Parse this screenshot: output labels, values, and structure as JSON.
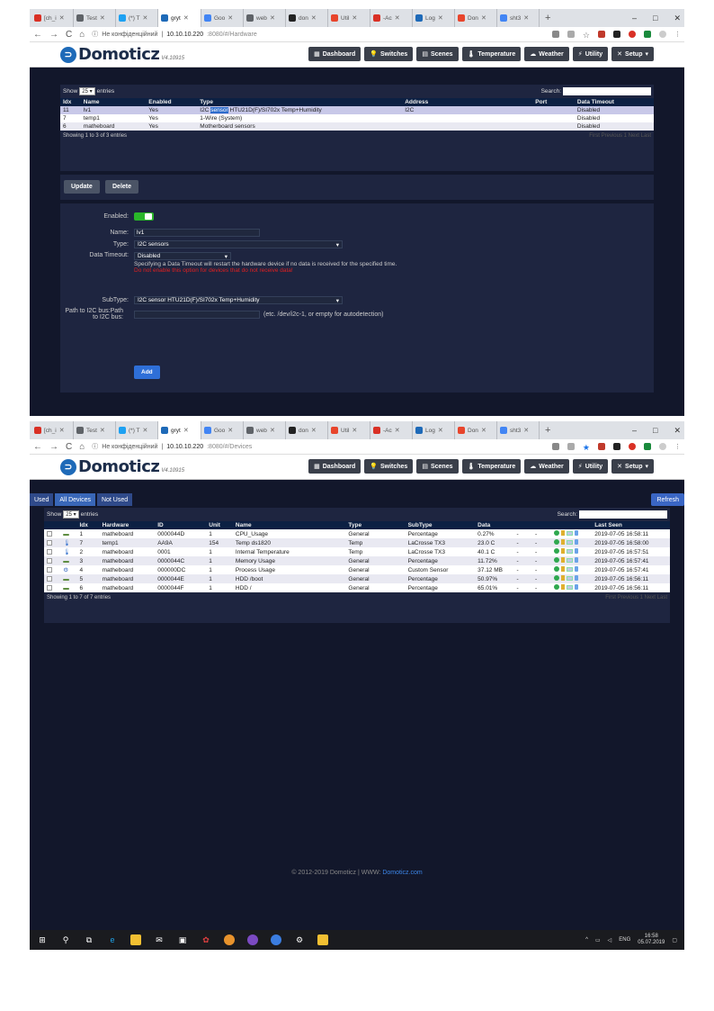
{
  "browser": {
    "tabs": [
      "[ch_i",
      "Test",
      "(*) T",
      "gryt",
      "Goo",
      "web",
      "don",
      "Util",
      "-Ac",
      "Log",
      "Don",
      "sht3"
    ],
    "tab_colors": [
      "#d93025",
      "#5f6368",
      "#1da1f2",
      "#1e6ab8",
      "#4285f4",
      "#5f6368",
      "#222222",
      "#e8452c",
      "#d93025",
      "#1e6ab8",
      "#e8452c",
      "#4285f4"
    ],
    "security_text": "Не конфіденційний",
    "host1": "10.10.10.220",
    "path1": ":8080/#/Hardware",
    "host2": "10.10.10.220",
    "path2": ":8080/#/Devices",
    "min": "–",
    "max": "□",
    "close": "✕",
    "plus": "+"
  },
  "app": {
    "logo": "Domoticz",
    "version": "V4.10915",
    "menu": [
      "Dashboard",
      "Switches",
      "Scenes",
      "Temperature",
      "Weather",
      "Utility",
      "Setup"
    ]
  },
  "hardware": {
    "show_prefix": "Show",
    "show_value": "25",
    "show_suffix": "entries",
    "search_label": "Search:",
    "columns": [
      "Idx",
      "Name",
      "Enabled",
      "Type",
      "Address",
      "Port",
      "Data Timeout"
    ],
    "rows": [
      {
        "idx": "11",
        "name": "lv1",
        "enabled": "Yes",
        "type_pre": "I2C ",
        "type_hl": "sensor",
        "type_post": " HTU21D(F)/SI702x Temp+Humidity",
        "address": "I2C",
        "port": "",
        "timeout": "Disabled"
      },
      {
        "idx": "7",
        "name": "temp1",
        "enabled": "Yes",
        "type_pre": "1-Wire (System)",
        "type_hl": "",
        "type_post": "",
        "address": "",
        "port": "",
        "timeout": "Disabled"
      },
      {
        "idx": "6",
        "name": "matheboard",
        "enabled": "Yes",
        "type_pre": "Motherboard sensors",
        "type_hl": "",
        "type_post": "",
        "address": "",
        "port": "",
        "timeout": "Disabled"
      }
    ],
    "showing": "Showing 1 to 3 of 3 entries",
    "pager": "First  Previous  1  Next  Last",
    "update_btn": "Update",
    "delete_btn": "Delete",
    "form": {
      "enabled_label": "Enabled:",
      "name_label": "Name:",
      "name_value": "lv1",
      "type_label": "Type:",
      "type_value": "I2C sensors",
      "timeout_label": "Data Timeout:",
      "timeout_value": "Disabled",
      "timeout_note": "Specifying a Data Timeout will restart the hardware device if no data is received for the specified time.",
      "timeout_warn": "Do not enable this option for devices that do not receive data!",
      "subtype_label": "SubType:",
      "subtype_value": "I2C sensor HTU21D(F)/SI702x Temp+Humidity",
      "path_label": "Path to I2C bus:Path to I2C bus:",
      "path_hint": "(etc. /dev/i2c-1, or empty for autodetection)",
      "add_btn": "Add"
    }
  },
  "devices": {
    "tabs": [
      "Used",
      "All Devices",
      "Not Used"
    ],
    "refresh": "Refresh",
    "show_prefix": "Show",
    "show_value": "25",
    "show_suffix": "entries",
    "search_label": "Search:",
    "columns": [
      "",
      "",
      "Idx",
      "Hardware",
      "ID",
      "Unit",
      "Name",
      "Type",
      "SubType",
      "Data",
      "",
      "",
      "",
      "Last Seen"
    ],
    "rows": [
      {
        "icon": "monitor",
        "idx": "1",
        "hw": "matheboard",
        "id": "0000044D",
        "unit": "1",
        "name": "CPU_Usage",
        "type": "General",
        "sub": "Percentage",
        "data": "0.27%",
        "seen": "2019-07-05 16:58:11"
      },
      {
        "icon": "thermo",
        "idx": "7",
        "hw": "temp1",
        "id": "AA9A",
        "unit": "154",
        "name": "Temp ds1820",
        "type": "Temp",
        "sub": "LaCrosse TX3",
        "data": "23.0 C",
        "seen": "2019-07-05 16:58:00"
      },
      {
        "icon": "thermo",
        "idx": "2",
        "hw": "matheboard",
        "id": "0001",
        "unit": "1",
        "name": "Internal Temperature",
        "type": "Temp",
        "sub": "LaCrosse TX3",
        "data": "40.1 C",
        "seen": "2019-07-05 16:57:51"
      },
      {
        "icon": "monitor",
        "idx": "3",
        "hw": "matheboard",
        "id": "0000044C",
        "unit": "1",
        "name": "Memory Usage",
        "type": "General",
        "sub": "Percentage",
        "data": "11.72%",
        "seen": "2019-07-05 16:57:41"
      },
      {
        "icon": "gear",
        "idx": "4",
        "hw": "matheboard",
        "id": "000000DC",
        "unit": "1",
        "name": "Process Usage",
        "type": "General",
        "sub": "Custom Sensor",
        "data": "37.12 MB",
        "seen": "2019-07-05 16:57:41"
      },
      {
        "icon": "monitor",
        "idx": "5",
        "hw": "matheboard",
        "id": "0000044E",
        "unit": "1",
        "name": "HDD /boot",
        "type": "General",
        "sub": "Percentage",
        "data": "50.97%",
        "seen": "2019-07-05 16:56:11"
      },
      {
        "icon": "monitor",
        "idx": "6",
        "hw": "matheboard",
        "id": "0000044F",
        "unit": "1",
        "name": "HDD /",
        "type": "General",
        "sub": "Percentage",
        "data": "65.01%",
        "seen": "2019-07-05 16:56:11"
      }
    ],
    "dash": "-",
    "showing": "Showing 1 to 7 of 7 entries",
    "pager": "First  Previous  1  Next  Last",
    "copyright": "© 2012-2019 Domoticz | WWW:",
    "link": "Domoticz.com"
  },
  "taskbar": {
    "lang": "ENG",
    "time": "16:58",
    "date": "05.07.2019"
  }
}
